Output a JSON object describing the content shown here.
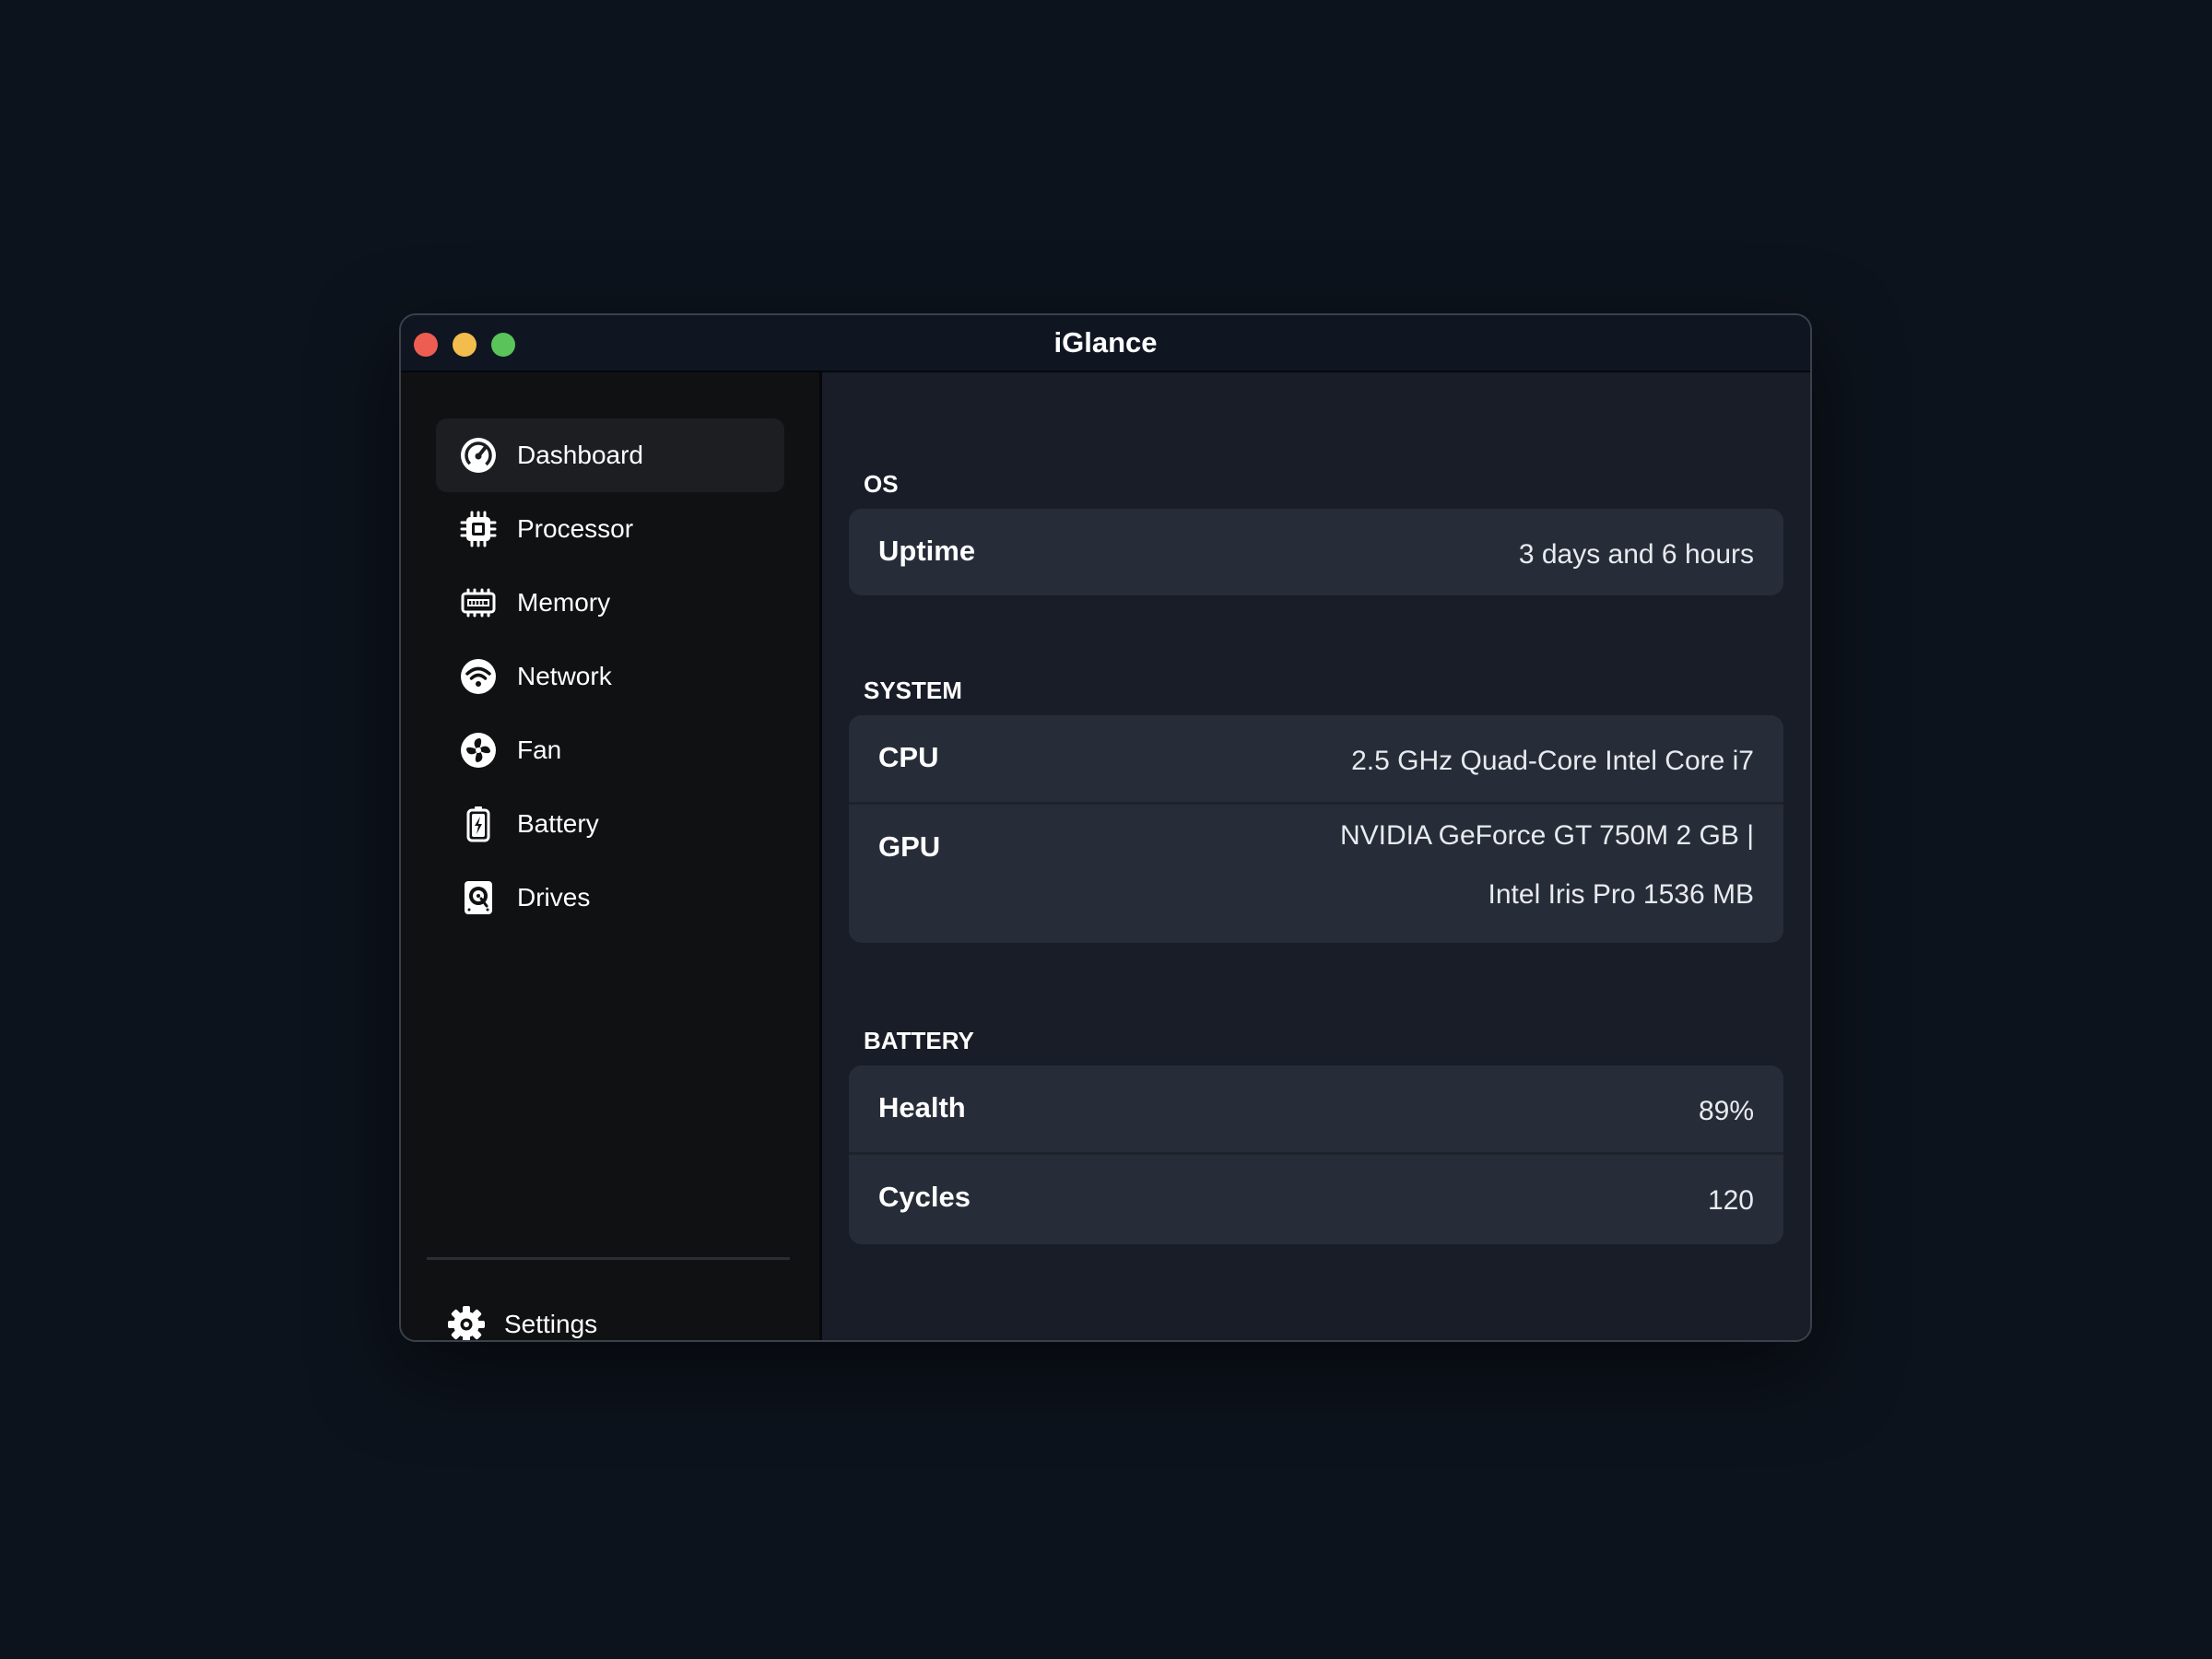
{
  "window": {
    "title": "iGlance"
  },
  "sidebar": {
    "items": [
      {
        "label": "Dashboard",
        "icon": "gauge-icon",
        "active": true
      },
      {
        "label": "Processor",
        "icon": "cpu-chip-icon",
        "active": false
      },
      {
        "label": "Memory",
        "icon": "memory-module-icon",
        "active": false
      },
      {
        "label": "Network",
        "icon": "wifi-icon",
        "active": false
      },
      {
        "label": "Fan",
        "icon": "fan-icon",
        "active": false
      },
      {
        "label": "Battery",
        "icon": "battery-icon",
        "active": false
      },
      {
        "label": "Drives",
        "icon": "hard-drive-icon",
        "active": false
      }
    ],
    "settings": {
      "label": "Settings",
      "icon": "gear-icon"
    }
  },
  "sections": {
    "os": {
      "title": "OS",
      "rows": [
        {
          "key": "Uptime",
          "value": "3 days and 6 hours"
        }
      ]
    },
    "system": {
      "title": "SYSTEM",
      "rows": [
        {
          "key": "CPU",
          "value": "2.5 GHz Quad-Core Intel Core i7"
        },
        {
          "key": "GPU",
          "value_line1": "NVIDIA GeForce GT 750M 2 GB |",
          "value_line2": "Intel Iris Pro 1536 MB"
        }
      ]
    },
    "battery": {
      "title": "BATTERY",
      "rows": [
        {
          "key": "Health",
          "value": "89%"
        },
        {
          "key": "Cycles",
          "value": "120"
        }
      ]
    }
  },
  "colors": {
    "background": "#0d131c",
    "sidebar": "#101113",
    "content": "#181d27",
    "card": "#272d38",
    "close": "#ee5d52",
    "minimize": "#f3bd4e",
    "maximize": "#5ac35a"
  }
}
